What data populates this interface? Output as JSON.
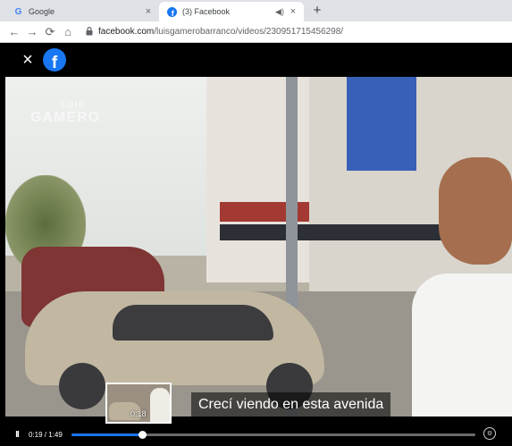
{
  "browser": {
    "tabs": [
      {
        "title": "Google",
        "icon": "google-g-icon",
        "close": "×"
      },
      {
        "title": "(3) Facebook",
        "icon": "facebook-icon",
        "close": "×",
        "audio": "◀)"
      }
    ],
    "new_tab": "+",
    "url_host": "facebook.com",
    "url_path": "/luisgamerobarranco/videos/230951715456298/",
    "nav": {
      "back": "←",
      "forward": "→",
      "reload": "⟳",
      "home": "⌂",
      "lock": "🔒"
    }
  },
  "viewer": {
    "close": "×",
    "logo": "f",
    "watermark_line1": "Luis",
    "watermark_line2": "GAMERO",
    "subtitle": "Crecí viendo en esta avenida",
    "preview_time": "0:18",
    "current_time": "0:19 / 1:49",
    "progress_fraction": 0.174,
    "pause": "II",
    "accent_color": "#1877f2"
  }
}
